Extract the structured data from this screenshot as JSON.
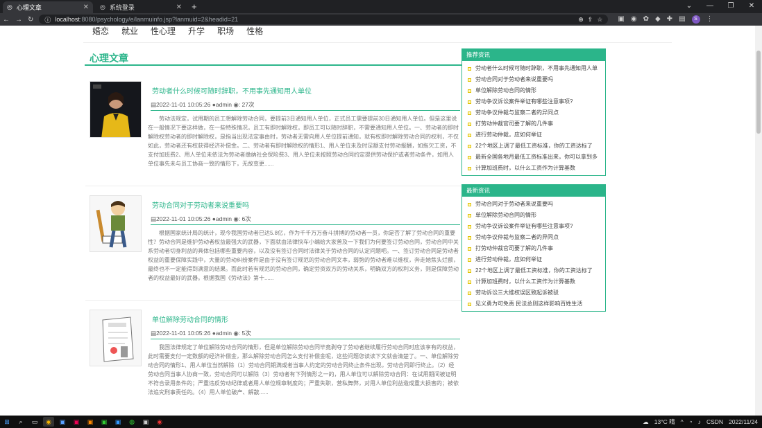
{
  "browser": {
    "tabs": [
      {
        "label": "心理文章",
        "active": true
      },
      {
        "label": "系统登录",
        "active": false
      }
    ],
    "url_host": "localhost",
    "url_rest": ":8080/psychology/e/lanmuinfo.jsp?lanmuid=2&headid=21",
    "profile_initial": "S"
  },
  "nav": [
    "婚恋",
    "就业",
    "性心理",
    "升学",
    "职场",
    "性格"
  ],
  "section_title": "心理文章",
  "articles": [
    {
      "title": "劳动者什么时候可随时辞职，不用事先通知用人单位",
      "date": "2022-11-01 10:05:26",
      "author": "admin",
      "views": "27次",
      "body": "劳动法规定，试用期的员工想解除劳动合同，要提前3日通知用人单位，正式员工需要提前30日通知用人单位。但是这里说在一般情况下要这样做，在一些特殊情况，员工有即时解除权，即员工可以随时辞职，不需要通知用人单位。一、劳动者的即时解除权劳动者的即时解除权，是指当出现法定事由时，劳动者无需向用人单位提前通知，就有权即时解除劳动合同的权利，不仅如此，劳动者还有权获得经济补偿金。二、劳动者有即时解除权的情形1、用人单位未及时足额支付劳动报酬，如拖欠工资，不支付加班费2、用人单位未依法为劳动者缴纳社会保险费3、用人单位未按照劳动合同约定提供劳动保护或者劳动条件，如用人单位事先未与员工协商一致的情形下，无故变更......"
    },
    {
      "title": "劳动合同对于劳动者来说重要吗",
      "date": "2022-11-01 10:05:26",
      "author": "admin",
      "views": "6次",
      "body": "根据国家统计局的统计，现今我国劳动者已达5.8亿，作为千千万万奋斗拼搏的劳动者一员，你是否了解了劳动合同的重要性？劳动合同是维护劳动者权益最强大的武器，下面就由法律快车小编给大家普及一下我们为何要签订劳动合同，劳动合同中关系劳动者切身利益的具体包括哪些重要内容，以及没有签订合同时法律关于劳动合同的认定问题吧。一、签订劳动合同是劳动者权益的重要保障实践中，大量的劳动纠纷案件是由于没有签订规范的劳动合同文本，弱势的劳动者难以维权，奔走她焦头烂额，最终也不一定能得到满意的结果。而此时若有规范的劳动合同，确定劳资双方的劳动关系，明确双方的权利义务，则是保障劳动者的权益最好的武器。根据我国《劳动法》第十......"
    },
    {
      "title": "单位解除劳动合同的情形",
      "date": "2022-11-01 10:05:26",
      "author": "admin",
      "views": "5次",
      "body": "我国法律规定了单位解除劳动合同的情形，但是单位解除劳动合同毕竟剥夺了劳动者继续履行劳动合同时应该享有的权益，此时需要支付一定数额的经济补偿金，那么解除劳动合同怎么支付补偿金呢，这些问题您读读下文就会清楚了。一、单位解除劳动合同的情形1、用人单位当然解除（1）劳动合同期满或者当事人约定的劳动合同终止条件出现，劳动合同即行终止。（2）经劳动合同当事人协商一致，劳动合同可以解除（3）劳动者有下列情形之一的，用人单位可以解除劳动合同：在试用期间被证明不符合录用条件的；严重违反劳动纪律或者用人单位规章制度的；严重失职，营私舞弊，对用人单位利益造成重大损害的；被依法追究刑事责任的。（4）用人单位破产、解散......"
    }
  ],
  "sidebar": {
    "recommended_title": "推荐资讯",
    "recommended": [
      "劳动者什么时候可随时辞职，不用事先通知用人单",
      "劳动合同对于劳动者来说重要吗",
      "单位解除劳动合同的情形",
      "劳动争议诉讼案件举证有哪些注意事项?",
      "劳动争议仲裁与监察二者的异同点",
      "打劳动仲裁官司要了解的几件事",
      "进行劳动仲裁，应如何举证",
      "22个地区上调了最低工资标准，你的工资达标了",
      "最新全国各地月最低工资标准出来，你可以拿到多",
      "计算加班费时，以什么工资作为计算基数"
    ],
    "latest_title": "最新资讯",
    "latest": [
      "劳动合同对于劳动者来说重要吗",
      "单位解除劳动合同的情形",
      "劳动争议诉讼案件举证有哪些注意事项?",
      "劳动争议仲裁与监察二者的异同点",
      "打劳动仲裁官司要了解的几件事",
      "进行劳动仲裁，应如何举证",
      "22个地区上调了最低工资标准，你的工资达标了",
      "计算加班费时，以什么工资作为计算基数",
      "劳动诉讼三大维权误区致起诉被驳",
      "见义勇为可免责 民法总则这样影响百姓生活"
    ]
  },
  "taskbar": {
    "weather": "13°C 晴",
    "csdn": "CSDN",
    "clock": "2022/11/24"
  },
  "colors": {
    "accent": "#2bb58a"
  }
}
